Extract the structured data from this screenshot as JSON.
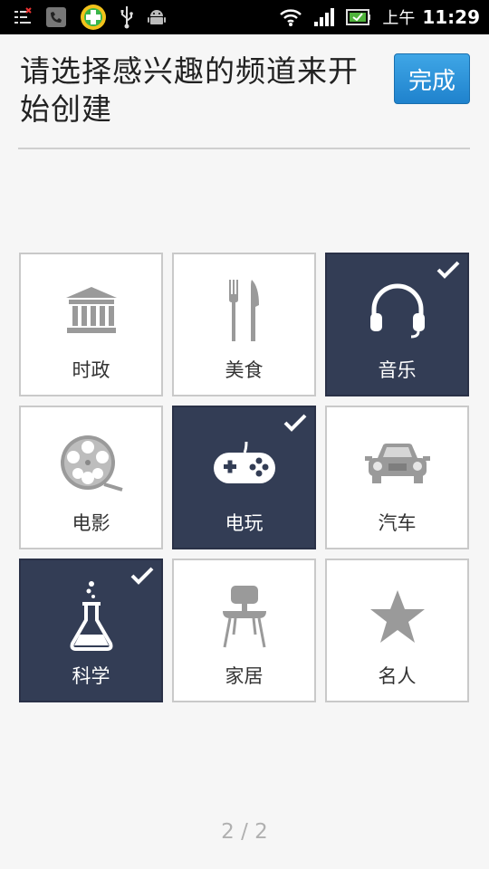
{
  "status_bar": {
    "ampm": "上午",
    "time": "11:29"
  },
  "header": {
    "title": "请选择感兴趣的频道来开始创建",
    "done_label": "完成"
  },
  "channels": [
    {
      "label": "时政",
      "icon": "government-building-icon",
      "selected": false
    },
    {
      "label": "美食",
      "icon": "fork-knife-icon",
      "selected": false
    },
    {
      "label": "音乐",
      "icon": "headphones-icon",
      "selected": true
    },
    {
      "label": "电影",
      "icon": "film-reel-icon",
      "selected": false
    },
    {
      "label": "电玩",
      "icon": "gamepad-icon",
      "selected": true
    },
    {
      "label": "汽车",
      "icon": "car-icon",
      "selected": false
    },
    {
      "label": "科学",
      "icon": "flask-icon",
      "selected": true
    },
    {
      "label": "家居",
      "icon": "chair-icon",
      "selected": false
    },
    {
      "label": "名人",
      "icon": "star-icon",
      "selected": false
    }
  ],
  "pager": "2 / 2",
  "colors": {
    "selected_tile": "#333d55",
    "button": "#2a8fd8"
  }
}
